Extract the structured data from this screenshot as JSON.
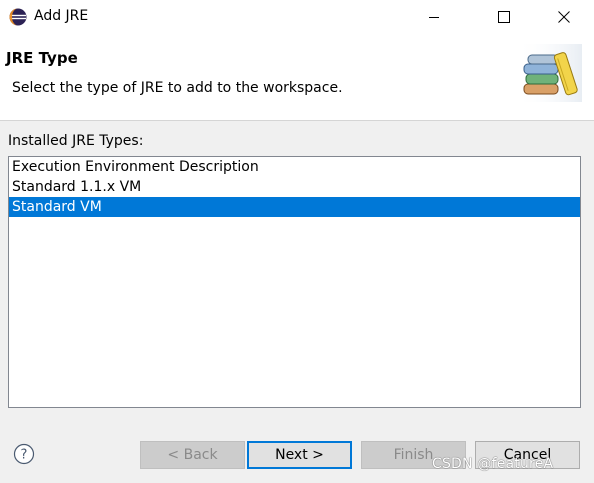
{
  "window": {
    "title": "Add JRE",
    "icon": "eclipse-icon",
    "controls": [
      "minimize-icon",
      "maximize-icon",
      "close-icon"
    ]
  },
  "header": {
    "title": "JRE Type",
    "description": "Select the type of JRE to add to the workspace.",
    "image": "books-icon"
  },
  "main": {
    "list_label": "Installed JRE Types:",
    "items": [
      {
        "label": "Execution Environment Description",
        "selected": false
      },
      {
        "label": "Standard 1.1.x VM",
        "selected": false
      },
      {
        "label": "Standard VM",
        "selected": true
      }
    ]
  },
  "buttons": {
    "help_icon": "help-icon",
    "back": "< Back",
    "next": "Next >",
    "finish": "Finish",
    "cancel": "Cancel"
  },
  "watermark": "CSDN @featureA",
  "colors": {
    "selection": "#0078d7",
    "default_button_border": "#0078d7",
    "dialog_background": "#f0f0f0"
  }
}
